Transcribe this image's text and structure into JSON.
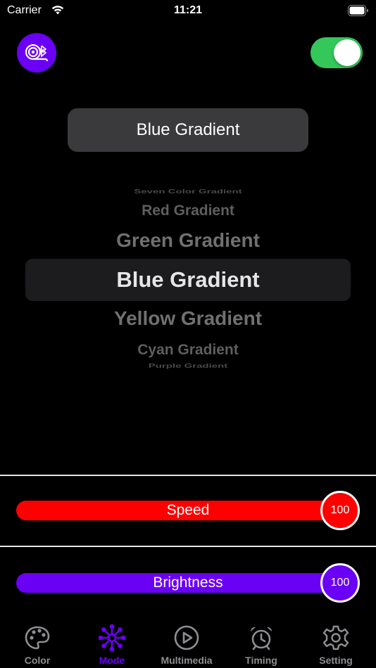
{
  "status_bar": {
    "carrier": "Carrier",
    "time": "11:21"
  },
  "power": {
    "on": true
  },
  "mode_button": {
    "label": "Blue Gradient"
  },
  "picker": {
    "items": [
      "Seven Color Gradient",
      "Red Gradient",
      "Green Gradient",
      "Blue Gradient",
      "Yellow Gradient",
      "Cyan Gradient",
      "Purple Gradient"
    ],
    "selected": "Blue Gradient"
  },
  "sliders": {
    "speed": {
      "label": "Speed",
      "value": "100",
      "color": "#ff0000"
    },
    "brightness": {
      "label": "Brightness",
      "value": "100",
      "color": "#6a00f4"
    }
  },
  "tabs": [
    {
      "label": "Color",
      "icon": "palette-icon"
    },
    {
      "label": "Mode",
      "icon": "mode-burst-icon",
      "active": true
    },
    {
      "label": "Multimedia",
      "icon": "play-circle-icon"
    },
    {
      "label": "Timing",
      "icon": "alarm-clock-icon"
    },
    {
      "label": "Setting",
      "icon": "gear-icon"
    }
  ],
  "colors": {
    "accent": "#6a00f4",
    "toggle_on": "#34c759",
    "speed": "#ff0000",
    "tab_inactive": "#8e8e93"
  }
}
